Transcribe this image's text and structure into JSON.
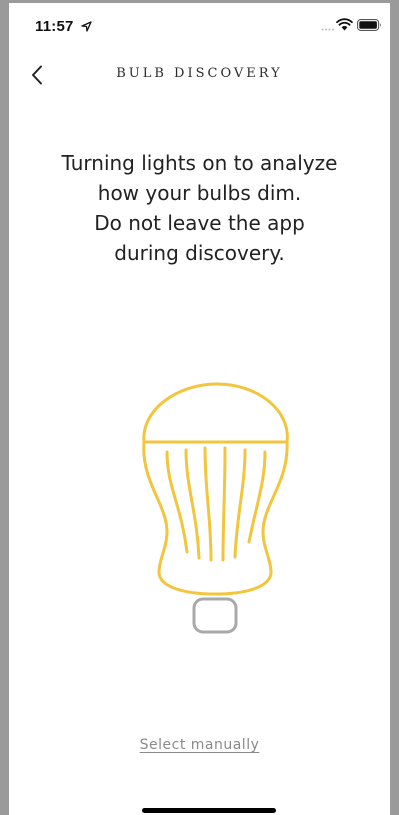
{
  "status_bar": {
    "time": "11:57",
    "icons": [
      "location-arrow-icon",
      "cellular-signal-icon",
      "wifi-icon",
      "battery-icon"
    ]
  },
  "nav": {
    "back_icon": "chevron-left-icon",
    "title": "BULB DISCOVERY"
  },
  "instruction": {
    "lines": [
      "Turning lights on to analyze",
      "how your bulbs dim.",
      "Do not leave the app",
      "during discovery."
    ]
  },
  "illustration": {
    "icon": "light-bulb-icon",
    "bulb_color": "#F2C53D",
    "base_color": "#A9A9A9"
  },
  "select_manually": {
    "label": "Select manually"
  },
  "colors": {
    "link_gray": "#8A8A8A",
    "text_dark": "#222222"
  }
}
